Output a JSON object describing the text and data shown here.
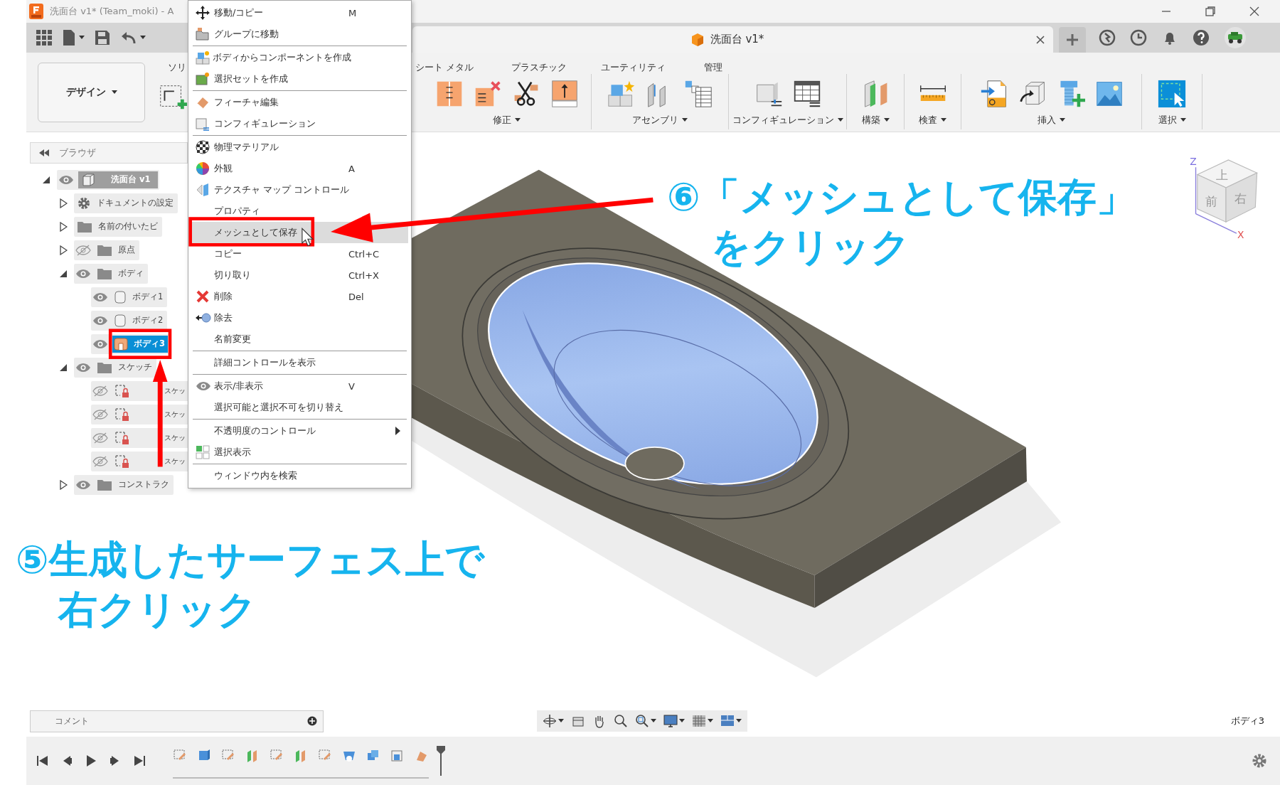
{
  "title_bar": {
    "title": "洗面台 v1* (Team_moki) - A"
  },
  "document_tab": {
    "title": "洗面台 v1*"
  },
  "ribbon": {
    "workspace": "デザイン",
    "tabs": [
      {
        "label": "ソリ"
      },
      {
        "label": "シート メタル"
      },
      {
        "label": "プラスチック"
      },
      {
        "label": "ユーティリティ"
      },
      {
        "label": "管理"
      }
    ],
    "groups": [
      {
        "label": "修正"
      },
      {
        "label": "アセンブリ"
      },
      {
        "label": "コンフィギュレーション"
      },
      {
        "label": "構築"
      },
      {
        "label": "検査"
      },
      {
        "label": "挿入"
      },
      {
        "label": "選択"
      }
    ]
  },
  "browser": {
    "title": "ブラウザ",
    "tree": [
      {
        "label": "洗面台 v1",
        "kind": "component",
        "expanded": true,
        "visible": true,
        "active": true,
        "selected": false,
        "children": [
          {
            "label": "ドキュメントの設定",
            "kind": "settings",
            "expanded": false,
            "selected": false
          },
          {
            "label": "名前の付いたビ",
            "kind": "folder",
            "expanded": false,
            "selected": false
          },
          {
            "label": "原点",
            "kind": "folder",
            "expanded": false,
            "visible": false,
            "selected": false
          },
          {
            "label": "ボディ",
            "kind": "folder",
            "expanded": true,
            "visible": true,
            "selected": false,
            "children": [
              {
                "label": "ボディ1",
                "kind": "body",
                "visible": true,
                "selected": false
              },
              {
                "label": "ボディ2",
                "kind": "body",
                "visible": true,
                "selected": false
              },
              {
                "label": "ボディ3",
                "kind": "surface",
                "visible": true,
                "selected": true
              }
            ]
          },
          {
            "label": "スケッチ",
            "kind": "folder",
            "expanded": true,
            "visible": true,
            "selected": false,
            "children": [
              {
                "label": "スケッ",
                "kind": "sketch",
                "visible": false,
                "selected": false
              },
              {
                "label": "スケッ",
                "kind": "sketch",
                "visible": false,
                "selected": false
              },
              {
                "label": "スケッ",
                "kind": "sketch",
                "visible": false,
                "selected": false
              },
              {
                "label": "スケッ",
                "kind": "sketch",
                "visible": false,
                "selected": false
              }
            ]
          },
          {
            "label": "コンストラク",
            "kind": "folder",
            "expanded": false,
            "visible": true,
            "selected": false
          }
        ]
      }
    ]
  },
  "context_menu": {
    "groups": [
      {
        "items": [
          {
            "label": "移動/コピー",
            "shortcut": "M",
            "selected": false,
            "submenu": false
          },
          {
            "label": "グループに移動",
            "selected": false,
            "submenu": false
          }
        ]
      },
      {
        "items": [
          {
            "label": "ボディからコンポーネントを作成",
            "selected": false,
            "submenu": false
          },
          {
            "label": "選択セットを作成",
            "selected": false,
            "submenu": false
          }
        ]
      },
      {
        "items": [
          {
            "label": "フィーチャ編集",
            "selected": false,
            "submenu": false
          },
          {
            "label": "コンフィギュレーション",
            "selected": false,
            "submenu": false
          }
        ]
      },
      {
        "items": [
          {
            "label": "物理マテリアル",
            "selected": false,
            "submenu": false
          },
          {
            "label": "外観",
            "shortcut": "A",
            "selected": false,
            "submenu": false
          },
          {
            "label": "テクスチャ マップ コントロール",
            "selected": false,
            "submenu": false
          },
          {
            "label": "プロパティ",
            "selected": false,
            "submenu": false
          },
          {
            "label": "メッシュとして保存",
            "selected": true,
            "submenu": false
          },
          {
            "label": "コピー",
            "shortcut": "Ctrl+C",
            "selected": false,
            "submenu": false
          },
          {
            "label": "切り取り",
            "shortcut": "Ctrl+X",
            "selected": false,
            "submenu": false
          },
          {
            "label": "削除",
            "shortcut": "Del",
            "selected": false,
            "submenu": false
          },
          {
            "label": "除去",
            "selected": false,
            "submenu": false
          },
          {
            "label": "名前変更",
            "selected": false,
            "submenu": false
          }
        ]
      },
      {
        "items": [
          {
            "label": "詳細コントロールを表示",
            "selected": false,
            "submenu": false
          }
        ]
      },
      {
        "items": [
          {
            "label": "表示/非表示",
            "shortcut": "V",
            "selected": false,
            "submenu": false
          },
          {
            "label": "選択可能と選択不可を切り替え",
            "selected": false,
            "submenu": false
          }
        ]
      },
      {
        "items": [
          {
            "label": "不透明度のコントロール",
            "selected": false,
            "submenu": true
          },
          {
            "label": "選択表示",
            "selected": false,
            "submenu": false
          }
        ]
      },
      {
        "items": [
          {
            "label": "ウィンドウ内を検索",
            "selected": false,
            "submenu": false
          }
        ]
      }
    ]
  },
  "viewcube": {
    "faces": [
      "上",
      "前",
      "右"
    ],
    "axes": [
      "Z",
      "X"
    ]
  },
  "annotations": [
    {
      "lines": [
        "⑥「メッシュとして保存」",
        "をクリック"
      ]
    },
    {
      "lines": [
        "⑤生成したサーフェス上で",
        "右クリック"
      ]
    }
  ],
  "comments": {
    "label": "コメント"
  },
  "status": {
    "selection": "ボディ3"
  }
}
